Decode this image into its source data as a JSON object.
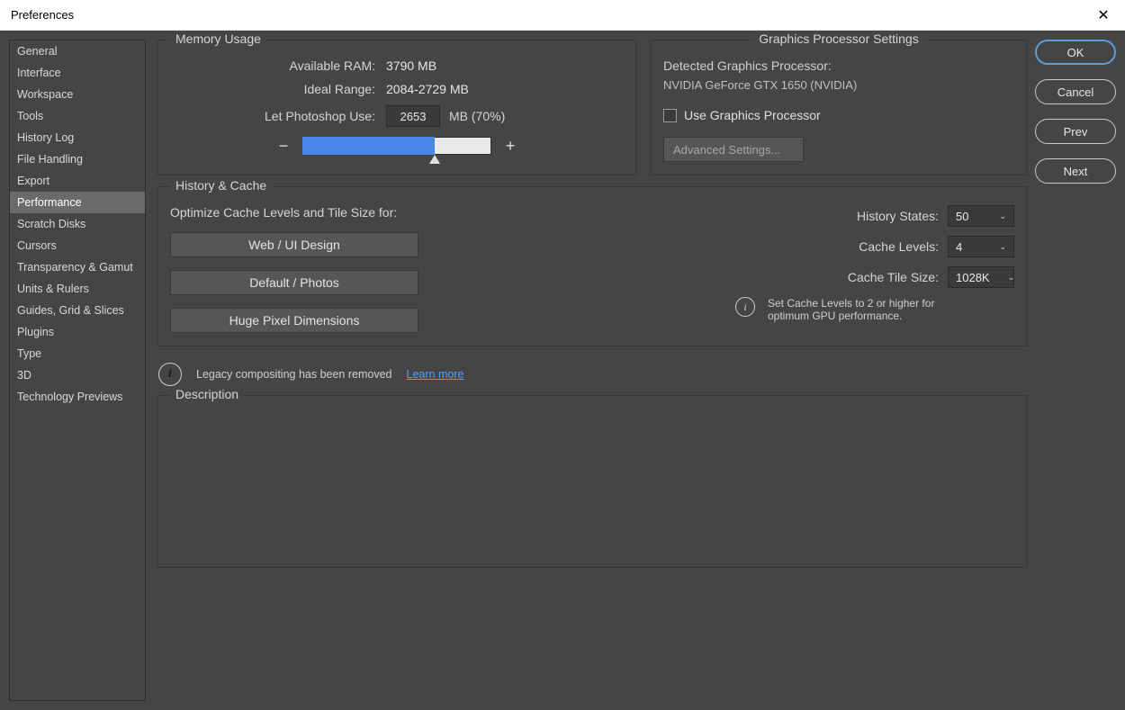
{
  "window": {
    "title": "Preferences"
  },
  "sidebar": {
    "items": [
      "General",
      "Interface",
      "Workspace",
      "Tools",
      "History Log",
      "File Handling",
      "Export",
      "Performance",
      "Scratch Disks",
      "Cursors",
      "Transparency & Gamut",
      "Units & Rulers",
      "Guides, Grid & Slices",
      "Plugins",
      "Type",
      "3D",
      "Technology Previews"
    ],
    "selected_index": 7
  },
  "buttons": {
    "ok": "OK",
    "cancel": "Cancel",
    "prev": "Prev",
    "next": "Next"
  },
  "memory": {
    "title": "Memory Usage",
    "available_label": "Available RAM:",
    "available_value": "3790 MB",
    "ideal_label": "Ideal Range:",
    "ideal_value": "2084-2729 MB",
    "use_label": "Let Photoshop Use:",
    "use_value": "2653",
    "use_suffix": "MB (70%)",
    "slider_percent": 70
  },
  "gpu": {
    "title": "Graphics Processor Settings",
    "detected_label": "Detected Graphics Processor:",
    "detected_value": "NVIDIA GeForce GTX 1650 (NVIDIA)",
    "use_label": "Use Graphics Processor",
    "use_checked": false,
    "advanced_label": "Advanced Settings..."
  },
  "history_cache": {
    "title": "History & Cache",
    "optimize_label": "Optimize Cache Levels and Tile Size for:",
    "presets": [
      "Web / UI Design",
      "Default / Photos",
      "Huge Pixel Dimensions"
    ],
    "history_states_label": "History States:",
    "history_states_value": "50",
    "cache_levels_label": "Cache Levels:",
    "cache_levels_value": "4",
    "cache_tile_label": "Cache Tile Size:",
    "cache_tile_value": "1028K",
    "info_text": "Set Cache Levels to 2 or higher for optimum GPU performance."
  },
  "legacy": {
    "text": "Legacy compositing has been removed",
    "learn_more": "Learn more"
  },
  "description": {
    "title": "Description"
  }
}
